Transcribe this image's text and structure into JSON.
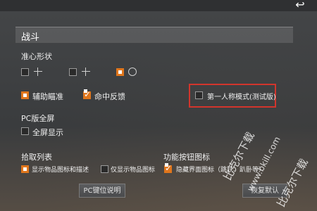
{
  "nav": {
    "back_icon": "back-arrow-icon"
  },
  "section": {
    "title": "战斗"
  },
  "crosshair": {
    "label": "准心形状",
    "options": [
      {
        "selected": false
      },
      {
        "selected": false
      },
      {
        "selected": true
      }
    ]
  },
  "checkboxes": {
    "aim_assist": {
      "label": "辅助瞄准",
      "checked": true
    },
    "hit_feedback": {
      "label": "命中反馈",
      "checked": true
    },
    "first_person": {
      "label": "第一人称模式(测试版)",
      "checked": false
    }
  },
  "pc_fullscreen": {
    "label": "PC版全屏",
    "option_label": "全屏显示",
    "checked": false
  },
  "pickup": {
    "label": "拾取列表",
    "show_icon_desc": "显示物品图标和描述",
    "show_icon_only": "仅显示物品图标"
  },
  "function_icons": {
    "label": "功能按钮图标",
    "hide_interface": "隐藏界面图标（跳跃、趴卧等）"
  },
  "buttons": {
    "pc_keys": "PC键位说明",
    "restore": "恢复默认"
  },
  "watermark": {
    "text1": "比克尔下载",
    "text2": "www.bkill.com",
    "text3": "比克尔下载"
  },
  "colors": {
    "accent": "#e0761c",
    "highlight": "#d2352c"
  }
}
